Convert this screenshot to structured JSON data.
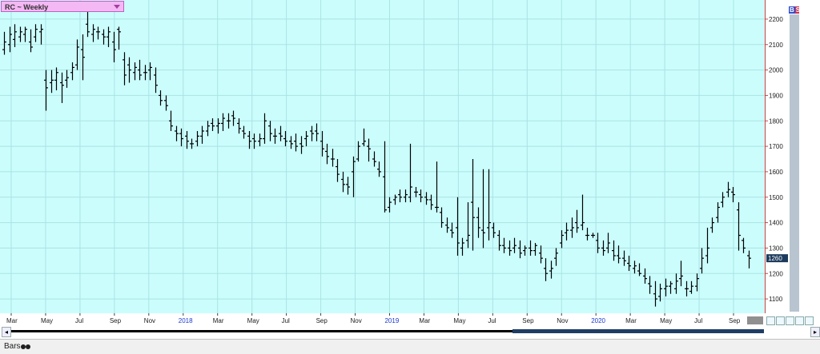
{
  "window": {
    "title": "RC ~ Weekly"
  },
  "bottom": {
    "mode_label": "Bars"
  },
  "colors": {
    "chart_bg": "#ccfdfd",
    "grid": "#a9e3e3",
    "bar": "#000000",
    "title_bg": "#f4b8f4"
  },
  "chart_data": {
    "type": "ohlc",
    "ylim": [
      1050,
      2250
    ],
    "yticks": [
      1100,
      1200,
      1300,
      1400,
      1500,
      1600,
      1700,
      1800,
      1900,
      2000,
      2100,
      2200
    ],
    "last_price": "1260",
    "xticks": [
      "Mar",
      "May",
      "Jul",
      "Sep",
      "Nov",
      "2018",
      "Mar",
      "May",
      "Jul",
      "Sep",
      "Nov",
      "2019",
      "Mar",
      "May",
      "Jul",
      "Sep",
      "Nov",
      "2020",
      "Mar",
      "May",
      "Jul",
      "Sep"
    ],
    "bars": [
      [
        2080,
        2150,
        2060,
        2110
      ],
      [
        2100,
        2170,
        2070,
        2140
      ],
      [
        2120,
        2180,
        2090,
        2150
      ],
      [
        2130,
        2170,
        2110,
        2150
      ],
      [
        2140,
        2170,
        2110,
        2160
      ],
      [
        2110,
        2160,
        2070,
        2090
      ],
      [
        2130,
        2180,
        2110,
        2160
      ],
      [
        2150,
        2180,
        2100,
        2160
      ],
      [
        1960,
        2000,
        1840,
        1930
      ],
      [
        1950,
        2000,
        1910,
        1960
      ],
      [
        1960,
        2010,
        1920,
        1990
      ],
      [
        1950,
        1990,
        1870,
        1940
      ],
      [
        1960,
        2000,
        1930,
        1970
      ],
      [
        1990,
        2030,
        1960,
        2010
      ],
      [
        2020,
        2120,
        2000,
        2090
      ],
      [
        2080,
        2140,
        1960,
        2050
      ],
      [
        2180,
        2230,
        2130,
        2150
      ],
      [
        2140,
        2180,
        2110,
        2160
      ],
      [
        2150,
        2170,
        2120,
        2150
      ],
      [
        2140,
        2160,
        2100,
        2130
      ],
      [
        2130,
        2170,
        2090,
        2150
      ],
      [
        2110,
        2150,
        2030,
        2080
      ],
      [
        2160,
        2170,
        2080,
        2150
      ],
      [
        2040,
        2070,
        1940,
        1980
      ],
      [
        2020,
        2050,
        1950,
        2000
      ],
      [
        1990,
        2030,
        1960,
        2010
      ],
      [
        2000,
        2040,
        1960,
        1980
      ],
      [
        1990,
        2020,
        1960,
        1990
      ],
      [
        2000,
        2030,
        1960,
        2010
      ],
      [
        1980,
        2010,
        1910,
        1940
      ],
      [
        1900,
        1920,
        1860,
        1880
      ],
      [
        1880,
        1900,
        1840,
        1860
      ],
      [
        1800,
        1840,
        1760,
        1780
      ],
      [
        1760,
        1780,
        1720,
        1750
      ],
      [
        1750,
        1770,
        1700,
        1730
      ],
      [
        1740,
        1760,
        1690,
        1720
      ],
      [
        1710,
        1730,
        1690,
        1710
      ],
      [
        1720,
        1760,
        1700,
        1740
      ],
      [
        1740,
        1780,
        1710,
        1760
      ],
      [
        1760,
        1800,
        1740,
        1780
      ],
      [
        1790,
        1810,
        1760,
        1780
      ],
      [
        1780,
        1810,
        1750,
        1790
      ],
      [
        1790,
        1830,
        1760,
        1810
      ],
      [
        1800,
        1830,
        1770,
        1800
      ],
      [
        1820,
        1840,
        1780,
        1810
      ],
      [
        1790,
        1810,
        1750,
        1770
      ],
      [
        1760,
        1780,
        1730,
        1750
      ],
      [
        1740,
        1760,
        1690,
        1720
      ],
      [
        1730,
        1750,
        1690,
        1720
      ],
      [
        1720,
        1750,
        1700,
        1730
      ],
      [
        1730,
        1830,
        1710,
        1800
      ],
      [
        1780,
        1800,
        1720,
        1750
      ],
      [
        1740,
        1770,
        1710,
        1740
      ],
      [
        1750,
        1780,
        1720,
        1740
      ],
      [
        1730,
        1760,
        1700,
        1720
      ],
      [
        1720,
        1740,
        1690,
        1710
      ],
      [
        1720,
        1750,
        1680,
        1700
      ],
      [
        1710,
        1740,
        1670,
        1700
      ],
      [
        1730,
        1760,
        1700,
        1740
      ],
      [
        1760,
        1780,
        1720,
        1750
      ],
      [
        1760,
        1790,
        1720,
        1750
      ],
      [
        1720,
        1760,
        1660,
        1690
      ],
      [
        1680,
        1710,
        1630,
        1660
      ],
      [
        1650,
        1690,
        1620,
        1650
      ],
      [
        1620,
        1650,
        1560,
        1590
      ],
      [
        1570,
        1600,
        1520,
        1550
      ],
      [
        1550,
        1580,
        1510,
        1540
      ],
      [
        1600,
        1660,
        1500,
        1640
      ],
      [
        1650,
        1720,
        1640,
        1700
      ],
      [
        1710,
        1770,
        1700,
        1720
      ],
      [
        1700,
        1730,
        1640,
        1690
      ],
      [
        1650,
        1680,
        1620,
        1640
      ],
      [
        1610,
        1640,
        1580,
        1600
      ],
      [
        1580,
        1720,
        1440,
        1450
      ],
      [
        1460,
        1500,
        1440,
        1480
      ],
      [
        1490,
        1510,
        1470,
        1500
      ],
      [
        1510,
        1530,
        1480,
        1500
      ],
      [
        1500,
        1530,
        1480,
        1510
      ],
      [
        1500,
        1710,
        1480,
        1540
      ],
      [
        1520,
        1540,
        1500,
        1520
      ],
      [
        1510,
        1530,
        1480,
        1500
      ],
      [
        1500,
        1520,
        1470,
        1490
      ],
      [
        1490,
        1510,
        1450,
        1470
      ],
      [
        1460,
        1640,
        1440,
        1460
      ],
      [
        1440,
        1460,
        1380,
        1400
      ],
      [
        1390,
        1420,
        1360,
        1380
      ],
      [
        1370,
        1400,
        1340,
        1360
      ],
      [
        1380,
        1500,
        1270,
        1320
      ],
      [
        1300,
        1340,
        1270,
        1320
      ],
      [
        1330,
        1480,
        1300,
        1350
      ],
      [
        1480,
        1650,
        1290,
        1420
      ],
      [
        1420,
        1460,
        1340,
        1380
      ],
      [
        1370,
        1610,
        1300,
        1360
      ],
      [
        1380,
        1610,
        1330,
        1400
      ],
      [
        1380,
        1400,
        1340,
        1360
      ],
      [
        1350,
        1370,
        1290,
        1310
      ],
      [
        1310,
        1340,
        1280,
        1300
      ],
      [
        1300,
        1330,
        1270,
        1290
      ],
      [
        1300,
        1340,
        1280,
        1310
      ],
      [
        1300,
        1330,
        1260,
        1280
      ],
      [
        1290,
        1310,
        1270,
        1300
      ],
      [
        1300,
        1330,
        1270,
        1290
      ],
      [
        1290,
        1320,
        1270,
        1310
      ],
      [
        1280,
        1310,
        1240,
        1260
      ],
      [
        1220,
        1260,
        1170,
        1200
      ],
      [
        1210,
        1250,
        1180,
        1220
      ],
      [
        1260,
        1300,
        1230,
        1280
      ],
      [
        1320,
        1370,
        1300,
        1350
      ],
      [
        1360,
        1400,
        1330,
        1370
      ],
      [
        1370,
        1420,
        1340,
        1380
      ],
      [
        1400,
        1450,
        1360,
        1380
      ],
      [
        1390,
        1510,
        1370,
        1400
      ],
      [
        1350,
        1380,
        1330,
        1350
      ],
      [
        1350,
        1360,
        1340,
        1350
      ],
      [
        1330,
        1360,
        1280,
        1300
      ],
      [
        1300,
        1330,
        1270,
        1290
      ],
      [
        1300,
        1360,
        1280,
        1320
      ],
      [
        1290,
        1330,
        1250,
        1270
      ],
      [
        1270,
        1310,
        1240,
        1260
      ],
      [
        1260,
        1290,
        1230,
        1250
      ],
      [
        1240,
        1270,
        1210,
        1230
      ],
      [
        1220,
        1250,
        1200,
        1230
      ],
      [
        1210,
        1240,
        1190,
        1200
      ],
      [
        1190,
        1220,
        1160,
        1180
      ],
      [
        1160,
        1190,
        1120,
        1150
      ],
      [
        1120,
        1170,
        1070,
        1100
      ],
      [
        1110,
        1160,
        1090,
        1140
      ],
      [
        1140,
        1180,
        1110,
        1150
      ],
      [
        1150,
        1170,
        1120,
        1160
      ],
      [
        1140,
        1200,
        1120,
        1170
      ],
      [
        1180,
        1250,
        1150,
        1190
      ],
      [
        1140,
        1170,
        1110,
        1140
      ],
      [
        1130,
        1170,
        1120,
        1150
      ],
      [
        1150,
        1200,
        1130,
        1180
      ],
      [
        1220,
        1300,
        1200,
        1260
      ],
      [
        1270,
        1380,
        1240,
        1300
      ],
      [
        1380,
        1420,
        1360,
        1400
      ],
      [
        1420,
        1480,
        1400,
        1460
      ],
      [
        1480,
        1520,
        1460,
        1500
      ],
      [
        1520,
        1560,
        1500,
        1530
      ],
      [
        1520,
        1540,
        1480,
        1510
      ],
      [
        1450,
        1480,
        1290,
        1350
      ],
      [
        1330,
        1340,
        1280,
        1300
      ],
      [
        1270,
        1290,
        1220,
        1260
      ]
    ]
  }
}
